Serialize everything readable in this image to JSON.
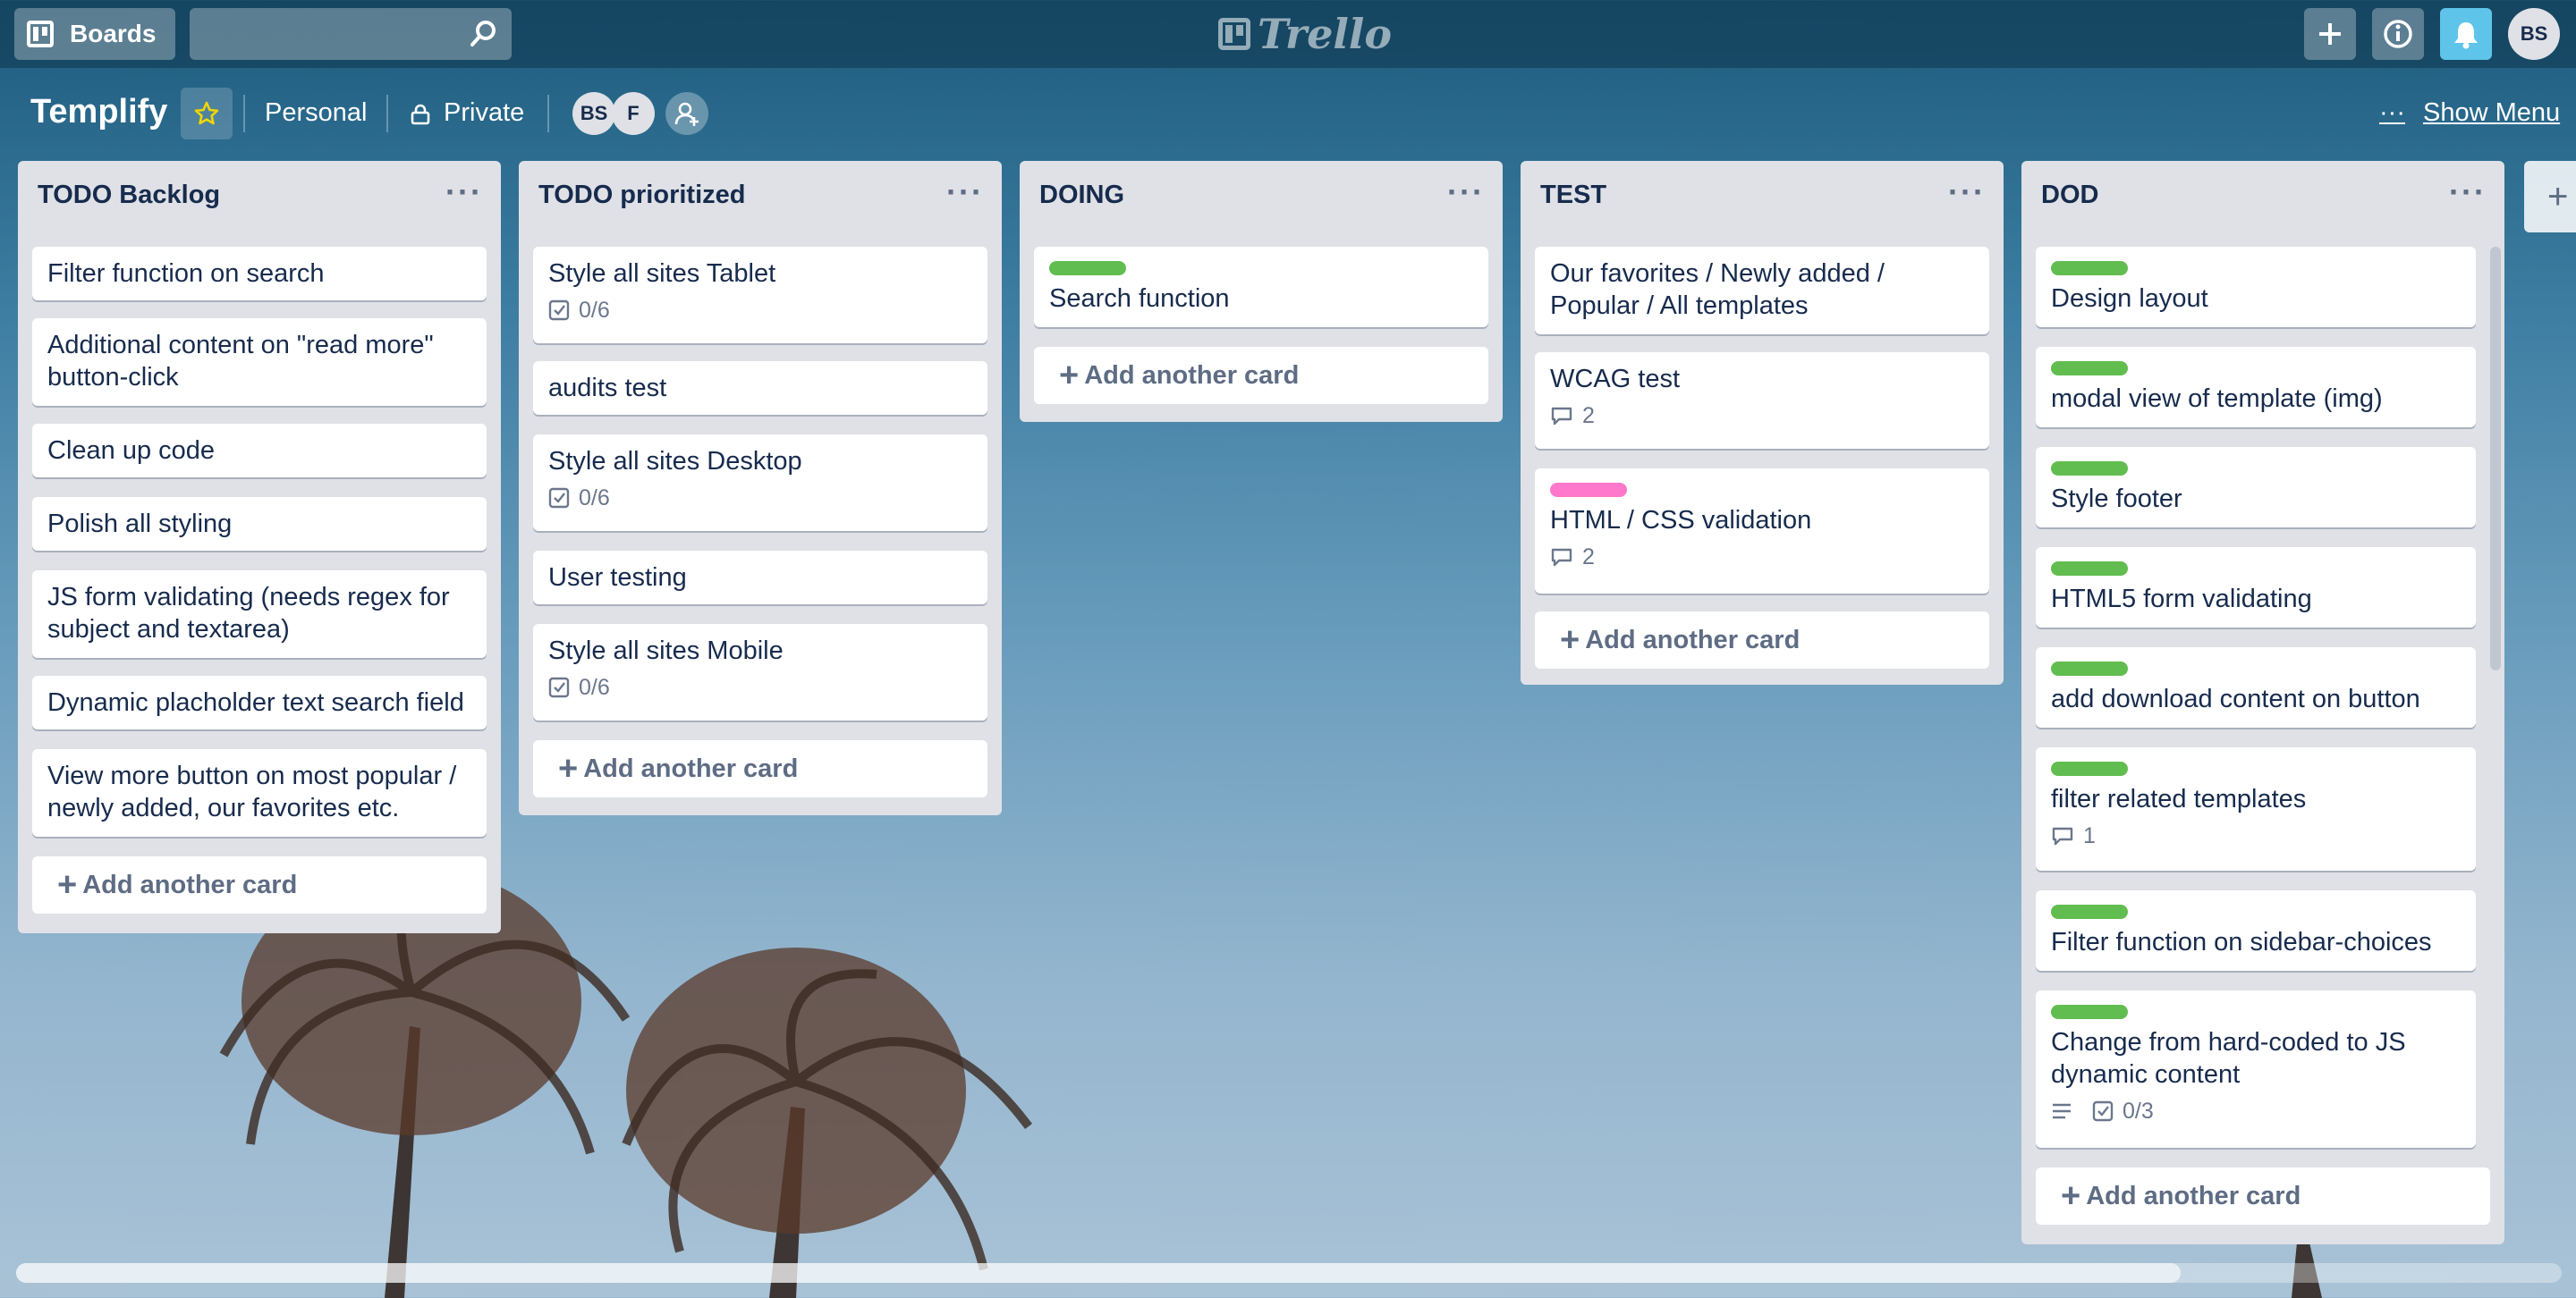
{
  "header": {
    "boards_label": "Boards",
    "search_placeholder": "",
    "logo_text": "Trello",
    "avatar_initials": "BS"
  },
  "board": {
    "title": "Templify",
    "team": "Personal",
    "visibility": "Private",
    "members": [
      "BS",
      "F"
    ],
    "show_menu": "Show Menu",
    "menu_dots": "···"
  },
  "add_card_label": "Add another card",
  "lists": [
    {
      "title": "TODO Backlog",
      "cards": [
        {
          "text": "Filter function on search"
        },
        {
          "text": "Additional content on \"read more\" button-click"
        },
        {
          "text": "Clean up code"
        },
        {
          "text": "Polish all styling"
        },
        {
          "text": "JS form validating (needs regex for subject and textarea)"
        },
        {
          "text": "Dynamic placholder text search field"
        },
        {
          "text": "View more button on most popular / newly added, our favorites etc."
        }
      ]
    },
    {
      "title": "TODO prioritized",
      "cards": [
        {
          "text": "Style all sites Tablet",
          "checklist": "0/6"
        },
        {
          "text": "audits test"
        },
        {
          "text": "Style all sites Desktop",
          "checklist": "0/6"
        },
        {
          "text": "User testing"
        },
        {
          "text": "Style all sites Mobile",
          "checklist": "0/6"
        }
      ]
    },
    {
      "title": "DOING",
      "cards": [
        {
          "text": "Search function",
          "label": "green"
        }
      ]
    },
    {
      "title": "TEST",
      "cards": [
        {
          "text": "Our favorites / Newly added / Popular / All templates"
        },
        {
          "text": "WCAG test",
          "comments": "2"
        },
        {
          "text": "HTML / CSS validation",
          "label": "pink",
          "comments": "2"
        }
      ]
    },
    {
      "title": "DOD",
      "cards": [
        {
          "text": "Design layout",
          "label": "green"
        },
        {
          "text": "modal view of template (img)",
          "label": "green"
        },
        {
          "text": "Style footer",
          "label": "green"
        },
        {
          "text": "HTML5 form validating",
          "label": "green"
        },
        {
          "text": "add download content on button",
          "label": "green"
        },
        {
          "text": "filter related templates",
          "label": "green",
          "comments": "1"
        },
        {
          "text": "Filter function on sidebar-choices",
          "label": "green"
        },
        {
          "text": "Change from hard-coded to JS dynamic content",
          "label": "green",
          "description": true,
          "checklist": "0/3"
        }
      ]
    }
  ],
  "colors": {
    "label_green": "#61bd4f",
    "label_pink": "#ff78cb",
    "notification": "#5ec4ea"
  }
}
